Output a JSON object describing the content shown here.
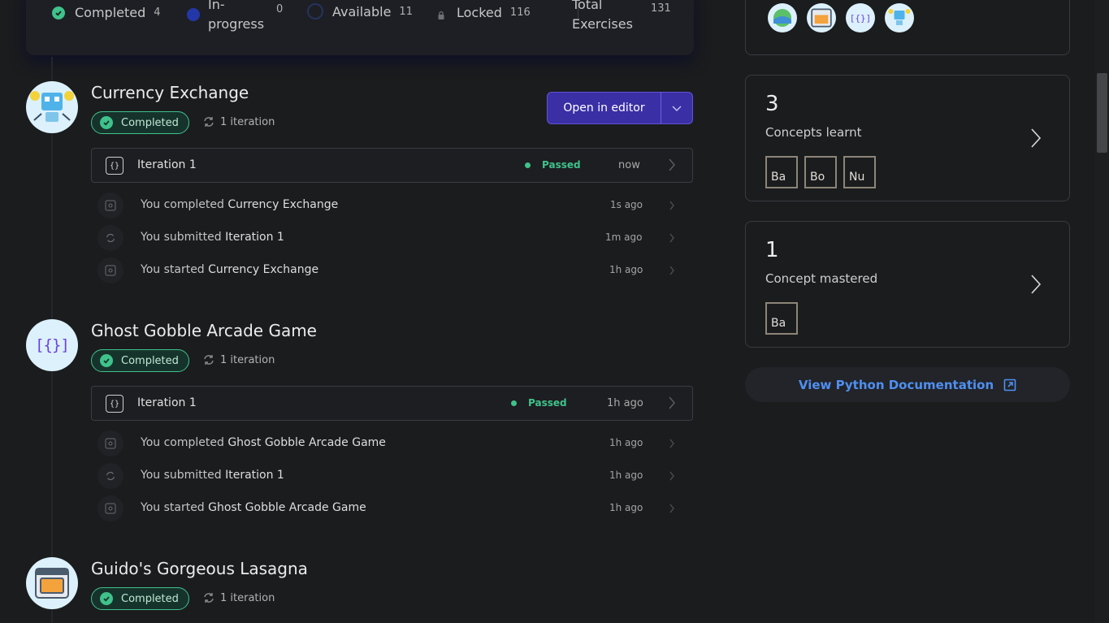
{
  "summary": {
    "completed": {
      "label": "Completed",
      "count": "4"
    },
    "in_progress": {
      "label": "In-\nprogress",
      "count": "0"
    },
    "available": {
      "label": "Available",
      "count": "11"
    },
    "locked": {
      "label": "Locked",
      "count": "116"
    },
    "total": {
      "label": "Total\nExercises",
      "count": "131"
    }
  },
  "exercises": [
    {
      "title": "Currency Exchange",
      "status": "Completed",
      "iterations": "1 iteration",
      "iteration": {
        "label": "Iteration 1",
        "status": "Passed",
        "when": "now"
      },
      "activities": [
        {
          "prefix": "You completed ",
          "target": "Currency Exchange",
          "when": "1s ago"
        },
        {
          "prefix": "You submitted ",
          "target": "Iteration 1",
          "when": "1m ago"
        },
        {
          "prefix": "You started ",
          "target": "Currency Exchange",
          "when": "1h ago"
        }
      ]
    },
    {
      "title": "Ghost Gobble Arcade Game",
      "status": "Completed",
      "iterations": "1 iteration",
      "avatar_text": "[{}]",
      "iteration": {
        "label": "Iteration 1",
        "status": "Passed",
        "when": "1h ago"
      },
      "activities": [
        {
          "prefix": "You completed ",
          "target": "Ghost Gobble Arcade Game",
          "when": "1h ago"
        },
        {
          "prefix": "You submitted ",
          "target": "Iteration 1",
          "when": "1h ago"
        },
        {
          "prefix": "You started ",
          "target": "Ghost Gobble Arcade Game",
          "when": "1h ago"
        }
      ]
    },
    {
      "title": "Guido's Gorgeous Lasagna",
      "status": "Completed",
      "iterations": "1 iteration"
    }
  ],
  "editor_button": {
    "label": "Open in editor"
  },
  "concepts_learnt": {
    "count": "3",
    "label": "Concepts learnt",
    "items": [
      "Ba",
      "Bo",
      "Nu"
    ]
  },
  "concepts_mastered": {
    "count": "1",
    "label": "Concept mastered",
    "items": [
      "Ba"
    ]
  },
  "completed_avatars": {
    "avatar_3_text": "[{}]"
  },
  "docs_link": {
    "label": "View Python Documentation"
  },
  "colors": {
    "accent": "#3fc28b",
    "primary": "#3a2fa5",
    "link": "#4f8ff0",
    "background": "#1b1c1e"
  },
  "icons": [
    "check-icon",
    "iteration-icon",
    "code-file-icon",
    "chevron-right-icon",
    "chevron-down-icon",
    "lock-icon",
    "external-link-icon"
  ]
}
